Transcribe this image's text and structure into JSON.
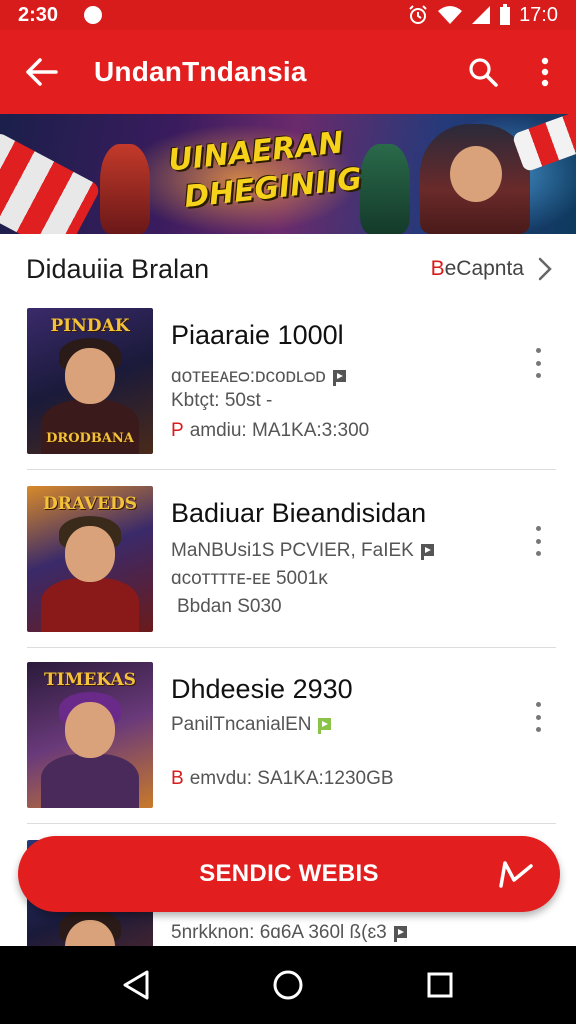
{
  "status_bar": {
    "time": "2:30",
    "clock_right": "17:0",
    "icons": [
      "alarm-icon",
      "wifi-icon",
      "signal-icon",
      "battery-icon"
    ]
  },
  "app_bar": {
    "title": "UndanTndansia",
    "back_icon": "arrow-back-icon",
    "actions": [
      "search-icon",
      "more-vert-icon"
    ]
  },
  "banner": {
    "line1": "UINAERAN",
    "line2": "DHEGINIIG"
  },
  "section": {
    "title": "Didauiia Bralan",
    "see_more_red": "B",
    "see_more_rest": "eCapnta"
  },
  "games": [
    {
      "thumb_title": "PINDAK",
      "thumb_subtitle": "DRODBANA",
      "name": "Piaaraie 1000l",
      "meta_line1": "ɑᴏᴛᴇᴇᴀᴇᴑ:ᴅᴄᴏᴅʟᴑᴅ",
      "meta_line2": "Kbtçt: 50st -",
      "meta_line3_red": "P",
      "meta_line3": "amdiu: MA1KA:3:300"
    },
    {
      "thumb_title": "DRAVEDS",
      "thumb_subtitle": "",
      "name": "Badiuar Bieandisidan",
      "meta_line1": "MaNBUsi1S PCVIER, FaIEK",
      "meta_line2": "ɑᴄᴏᴛᴛᴛᴛᴇ-ᴇᴇ 5001ᴋ",
      "meta_line3_red": "",
      "meta_line3": "Bbdan S030"
    },
    {
      "thumb_title": "TIMEKAS",
      "thumb_subtitle": "",
      "name": "Dhdeesie 2930",
      "meta_line1": "PanilTncanialEN",
      "meta_line2": "",
      "meta_line3_red": "B",
      "meta_line3": "emvdu: SA1KA:1230GB"
    },
    {
      "thumb_title": "",
      "thumb_subtitle": "",
      "name": "",
      "meta_line1": "5nrkknon: 6ɑ6A 360l ß(ɛ3",
      "meta_line2": "",
      "meta_line3_red": "",
      "meta_line3": ""
    }
  ],
  "fab": {
    "label": "SENDIC WEBIS",
    "icon": "send-icon"
  },
  "nav_bar": {
    "icons": [
      "nav-back-icon",
      "nav-home-icon",
      "nav-recents-icon"
    ]
  },
  "colors": {
    "primary": "#e21e1e",
    "status_bar": "#d81b1b",
    "accent_flag": "#8bc34a"
  }
}
